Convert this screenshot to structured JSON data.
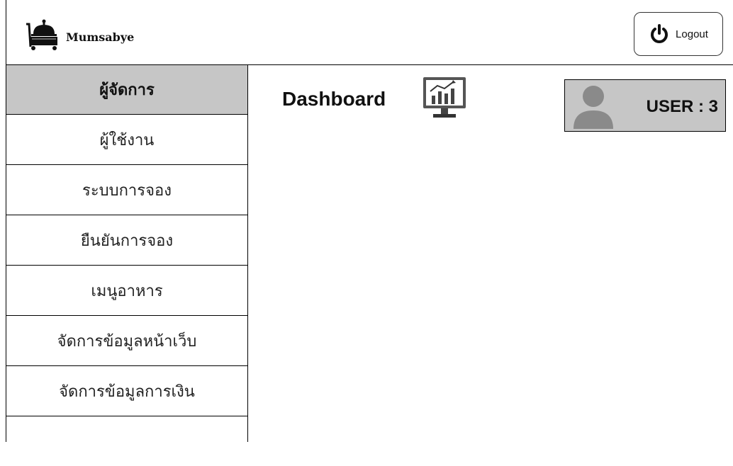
{
  "brand": {
    "name": "Mumsabye",
    "logo_icon": "hotel-bell-cart-icon"
  },
  "header": {
    "logout_label": "Logout",
    "logout_icon": "power-icon"
  },
  "sidebar": {
    "title": "ผู้จัดการ",
    "items": [
      {
        "label": "ผู้ใช้งาน"
      },
      {
        "label": "ระบบการจอง"
      },
      {
        "label": "ยืนยันการจอง"
      },
      {
        "label": "เมนูอาหาร"
      },
      {
        "label": "จัดการข้อมูลหน้าเว็บ"
      },
      {
        "label": "จัดการข้อมูลการเงิน"
      },
      {
        "label": ""
      }
    ]
  },
  "main": {
    "title": "Dashboard",
    "title_icon": "dashboard-monitor-chart-icon",
    "user_box": {
      "label": "USER : 3",
      "icon": "user-avatar-icon"
    }
  },
  "colors": {
    "panel_gray": "#c6c6c6",
    "border": "#000000",
    "background": "#ffffff"
  }
}
